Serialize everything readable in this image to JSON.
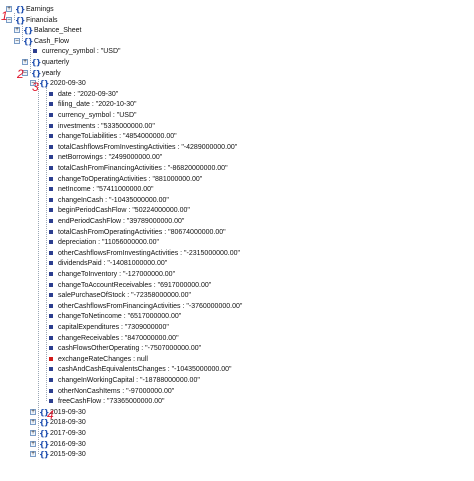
{
  "tree": [
    {
      "label": "Earnings",
      "kind": "object",
      "state": "collapsed",
      "depth": 1
    },
    {
      "label": "Financials",
      "kind": "object",
      "state": "expanded",
      "depth": 1
    },
    {
      "label": "Balance_Sheet",
      "kind": "object",
      "state": "collapsed",
      "depth": 2
    },
    {
      "label": "Cash_Flow",
      "kind": "object",
      "state": "expanded",
      "depth": 2
    },
    {
      "label": "currency_symbol : \"USD\"",
      "kind": "value",
      "depth": 3
    },
    {
      "label": "quarterly",
      "kind": "object",
      "state": "collapsed",
      "depth": 3
    },
    {
      "label": "yearly",
      "kind": "object",
      "state": "expanded",
      "depth": 3
    },
    {
      "label": "2020-09-30",
      "kind": "object",
      "state": "expanded",
      "depth": 4
    },
    {
      "label": "date : \"2020-09-30\"",
      "kind": "value",
      "depth": 5
    },
    {
      "label": "filing_date : \"2020-10-30\"",
      "kind": "value",
      "depth": 5
    },
    {
      "label": "currency_symbol : \"USD\"",
      "kind": "value",
      "depth": 5
    },
    {
      "label": "investments : \"5335000000.00\"",
      "kind": "value",
      "depth": 5
    },
    {
      "label": "changeToLiabilities : \"4854000000.00\"",
      "kind": "value",
      "depth": 5
    },
    {
      "label": "totalCashflowsFromInvestingActivities : \"-4289000000.00\"",
      "kind": "value",
      "depth": 5
    },
    {
      "label": "netBorrowings : \"2499000000.00\"",
      "kind": "value",
      "depth": 5
    },
    {
      "label": "totalCashFromFinancingActivities : \"-86820000000.00\"",
      "kind": "value",
      "depth": 5
    },
    {
      "label": "changeToOperatingActivities : \"881000000.00\"",
      "kind": "value",
      "depth": 5
    },
    {
      "label": "netIncome : \"57411000000.00\"",
      "kind": "value",
      "depth": 5
    },
    {
      "label": "changeInCash : \"-10435000000.00\"",
      "kind": "value",
      "depth": 5
    },
    {
      "label": "beginPeriodCashFlow : \"50224000000.00\"",
      "kind": "value",
      "depth": 5
    },
    {
      "label": "endPeriodCashFlow : \"39789000000.00\"",
      "kind": "value",
      "depth": 5
    },
    {
      "label": "totalCashFromOperatingActivities : \"80674000000.00\"",
      "kind": "value",
      "depth": 5
    },
    {
      "label": "depreciation : \"11056000000.00\"",
      "kind": "value",
      "depth": 5
    },
    {
      "label": "otherCashflowsFromInvestingActivities : \"-2315000000.00\"",
      "kind": "value",
      "depth": 5
    },
    {
      "label": "dividendsPaid : \"-14081000000.00\"",
      "kind": "value",
      "depth": 5
    },
    {
      "label": "changeToInventory : \"-127000000.00\"",
      "kind": "value",
      "depth": 5
    },
    {
      "label": "changeToAccountReceivables : \"6917000000.00\"",
      "kind": "value",
      "depth": 5
    },
    {
      "label": "salePurchaseOfStock : \"-72358000000.00\"",
      "kind": "value",
      "depth": 5
    },
    {
      "label": "otherCashflowsFromFinancingActivities : \"-3760000000.00\"",
      "kind": "value",
      "depth": 5
    },
    {
      "label": "changeToNetincome : \"6517000000.00\"",
      "kind": "value",
      "depth": 5
    },
    {
      "label": "capitalExpenditures : \"7309000000\"",
      "kind": "value",
      "depth": 5
    },
    {
      "label": "changeReceivables : \"8470000000.00\"",
      "kind": "value",
      "depth": 5
    },
    {
      "label": "cashFlowsOtherOperating : \"-7507000000.00\"",
      "kind": "value",
      "depth": 5
    },
    {
      "label": "exchangeRateChanges : null",
      "kind": "null",
      "depth": 5
    },
    {
      "label": "cashAndCashEquivalentsChanges : \"-10435000000.00\"",
      "kind": "value",
      "depth": 5
    },
    {
      "label": "changeInWorkingCapital : \"-18788000000.00\"",
      "kind": "value",
      "depth": 5
    },
    {
      "label": "otherNonCashItems : \"-97000000.00\"",
      "kind": "value",
      "depth": 5
    },
    {
      "label": "freeCashFlow : \"73365000000.00\"",
      "kind": "value",
      "depth": 5
    },
    {
      "label": "2019-09-30",
      "kind": "object",
      "state": "collapsed",
      "depth": 4
    },
    {
      "label": "2018-09-30",
      "kind": "object",
      "state": "collapsed",
      "depth": 4
    },
    {
      "label": "2017-09-30",
      "kind": "object",
      "state": "collapsed",
      "depth": 4
    },
    {
      "label": "2016-09-30",
      "kind": "object",
      "state": "collapsed",
      "depth": 4
    },
    {
      "label": "2015-09-30",
      "kind": "object",
      "state": "collapsed",
      "depth": 4
    }
  ],
  "annotations": [
    "1",
    "2",
    "3",
    "4"
  ],
  "colors": {
    "annotation": "#e0162b",
    "object_icon": "#1f4fb0",
    "leaf_icon": "#2c3e8f",
    "null_icon": "#d01919"
  }
}
